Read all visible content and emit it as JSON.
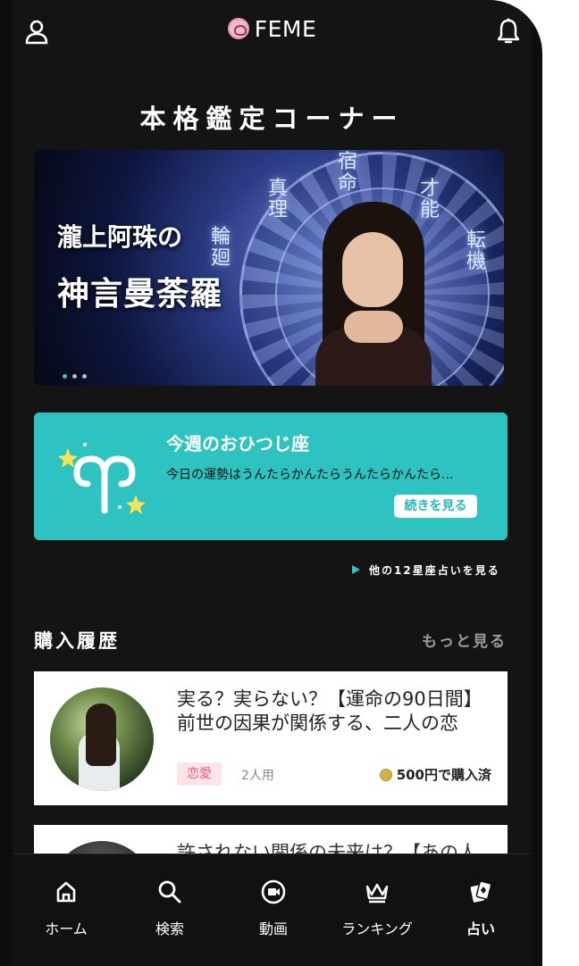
{
  "header": {
    "brand": "FEME"
  },
  "section_title": "本格鑑定コーナー",
  "banner": {
    "line1": "瀧上阿珠の",
    "line2": "神言曼荼羅",
    "kanji": [
      "宿命",
      "才能",
      "真理",
      "転機",
      "輪廻"
    ],
    "dots": 3,
    "active_dot": 0
  },
  "horoscope": {
    "title": "今週のおひつじ座",
    "desc": "今日の運勢はうんたらかんたらうんたらかんたら...",
    "more": "続きを見る"
  },
  "all_signs_link": "他の12星座占いを見る",
  "history": {
    "title": "購入履歴",
    "more": "もっと見る",
    "items": [
      {
        "title": "実る？実らない？【運命の90日間】前世の因果が関係する、二人の恋",
        "tag": "恋愛",
        "users": "2人用",
        "price": "500円で購入済"
      },
      {
        "title": "許されない関係の未来は？【あの人"
      }
    ]
  },
  "tabs": [
    {
      "label": "ホーム",
      "icon": "home-icon"
    },
    {
      "label": "検索",
      "icon": "search-icon"
    },
    {
      "label": "動画",
      "icon": "video-icon"
    },
    {
      "label": "ランキング",
      "icon": "crown-icon"
    },
    {
      "label": "占い",
      "icon": "tarot-card-icon",
      "active": true
    }
  ],
  "colors": {
    "accent": "#2ec3c1",
    "background": "#141414",
    "tag_bg": "#fde3ea",
    "tag_fg": "#e4607f"
  }
}
